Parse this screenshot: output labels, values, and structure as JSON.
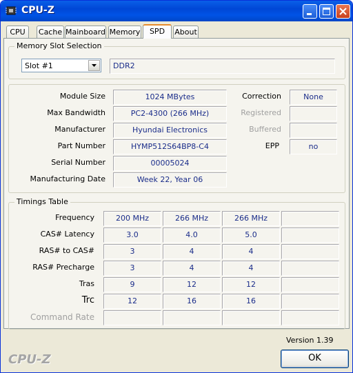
{
  "window": {
    "title": "CPU-Z"
  },
  "tabs": [
    {
      "label": "CPU"
    },
    {
      "label": "Cache"
    },
    {
      "label": "Mainboard"
    },
    {
      "label": "Memory"
    },
    {
      "label": "SPD"
    },
    {
      "label": "About"
    }
  ],
  "slot_selection": {
    "group_title": "Memory Slot Selection",
    "selected_slot": "Slot #1",
    "type": "DDR2"
  },
  "module": {
    "fields": [
      {
        "label": "Module Size",
        "value": "1024 MBytes"
      },
      {
        "label": "Max Bandwidth",
        "value": "PC2-4300 (266 MHz)"
      },
      {
        "label": "Manufacturer",
        "value": "Hyundai Electronics"
      },
      {
        "label": "Part Number",
        "value": "HYMP512S64BP8-C4"
      },
      {
        "label": "Serial Number",
        "value": "00005024"
      },
      {
        "label": "Manufacturing Date",
        "value": "Week 22, Year 06"
      }
    ],
    "correction_label": "Correction",
    "correction_value": "None",
    "registered_label": "Registered",
    "registered_value": "",
    "buffered_label": "Buffered",
    "buffered_value": "",
    "epp_label": "EPP",
    "epp_value": "no"
  },
  "timings": {
    "group_title": "Timings Table",
    "rows": [
      {
        "label": "Frequency",
        "values": [
          "200 MHz",
          "266 MHz",
          "266 MHz",
          ""
        ]
      },
      {
        "label": "CAS# Latency",
        "values": [
          "3.0",
          "4.0",
          "5.0",
          ""
        ]
      },
      {
        "label": "RAS# to CAS#",
        "values": [
          "3",
          "4",
          "4",
          ""
        ]
      },
      {
        "label": "RAS# Precharge",
        "values": [
          "3",
          "4",
          "4",
          ""
        ]
      },
      {
        "label": "Tras",
        "values": [
          "9",
          "12",
          "12",
          ""
        ]
      },
      {
        "label": "Trc",
        "values": [
          "12",
          "16",
          "16",
          ""
        ]
      },
      {
        "label": "Command Rate",
        "values": [
          "",
          "",
          "",
          ""
        ]
      }
    ]
  },
  "footer": {
    "version": "Version 1.39",
    "brand": "CPU-Z",
    "ok_label": "OK"
  }
}
